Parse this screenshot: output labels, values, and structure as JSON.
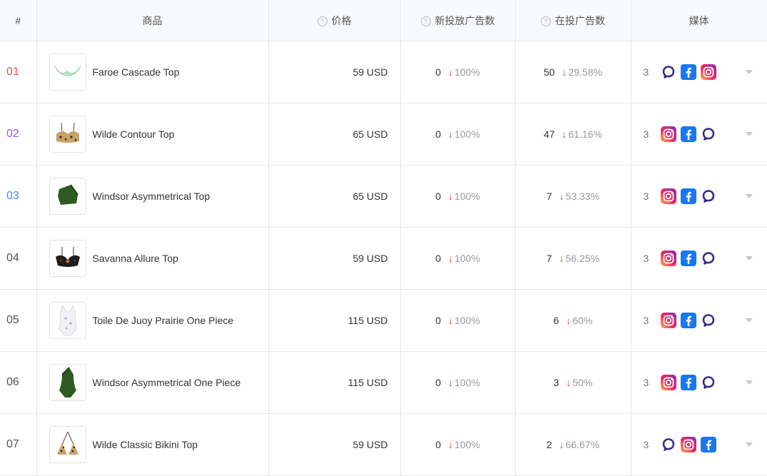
{
  "header": {
    "rank": "#",
    "product": "商品",
    "price": "价格",
    "new_ads": "新投放广告数",
    "current_ads": "在投广告数",
    "media": "媒体"
  },
  "colors": {
    "rank_1": "#f04a3f",
    "rank_2": "#9b59e6",
    "rank_3": "#3b8ff0",
    "rank_default": "#555555",
    "down_arrow": "#e8403f",
    "facebook": "#1877f2",
    "threads_like": "#3b2a8c"
  },
  "rows": [
    {
      "rank": "01",
      "name": "Faroe Cascade Top",
      "thumb_icon": "bikini-top-mint-icon",
      "price": "59 USD",
      "new_ads": "0",
      "new_pct": "100%",
      "cur_ads": "50",
      "cur_pct": "29.58%",
      "media_count": "3",
      "media": [
        "threads-icon",
        "facebook-icon",
        "instagram-icon"
      ]
    },
    {
      "rank": "02",
      "name": "Wilde Contour Top",
      "thumb_icon": "bikini-top-leopard-icon",
      "price": "65 USD",
      "new_ads": "0",
      "new_pct": "100%",
      "cur_ads": "47",
      "cur_pct": "61.16%",
      "media_count": "3",
      "media": [
        "instagram-icon",
        "facebook-icon",
        "threads-icon"
      ]
    },
    {
      "rank": "03",
      "name": "Windsor Asymmetrical Top",
      "thumb_icon": "top-green-icon",
      "price": "65 USD",
      "new_ads": "0",
      "new_pct": "100%",
      "cur_ads": "7",
      "cur_pct": "53.33%",
      "media_count": "3",
      "media": [
        "instagram-icon",
        "facebook-icon",
        "threads-icon"
      ]
    },
    {
      "rank": "04",
      "name": "Savanna Allure Top",
      "thumb_icon": "bikini-top-dark-icon",
      "price": "59 USD",
      "new_ads": "0",
      "new_pct": "100%",
      "cur_ads": "7",
      "cur_pct": "56.25%",
      "media_count": "3",
      "media": [
        "instagram-icon",
        "facebook-icon",
        "threads-icon"
      ]
    },
    {
      "rank": "05",
      "name": "Toile De Juoy Prairie One Piece",
      "thumb_icon": "one-piece-floral-icon",
      "price": "115 USD",
      "new_ads": "0",
      "new_pct": "100%",
      "cur_ads": "6",
      "cur_pct": "60%",
      "media_count": "3",
      "media": [
        "instagram-icon",
        "facebook-icon",
        "threads-icon"
      ]
    },
    {
      "rank": "06",
      "name": "Windsor Asymmetrical One Piece",
      "thumb_icon": "one-piece-green-icon",
      "price": "115 USD",
      "new_ads": "0",
      "new_pct": "100%",
      "cur_ads": "3",
      "cur_pct": "50%",
      "media_count": "3",
      "media": [
        "instagram-icon",
        "facebook-icon",
        "threads-icon"
      ]
    },
    {
      "rank": "07",
      "name": "Wilde Classic Bikini Top",
      "thumb_icon": "triangle-top-leopard-icon",
      "price": "59 USD",
      "new_ads": "0",
      "new_pct": "100%",
      "cur_ads": "2",
      "cur_pct": "66.67%",
      "media_count": "3",
      "media": [
        "threads-icon",
        "instagram-icon",
        "facebook-icon"
      ]
    }
  ]
}
